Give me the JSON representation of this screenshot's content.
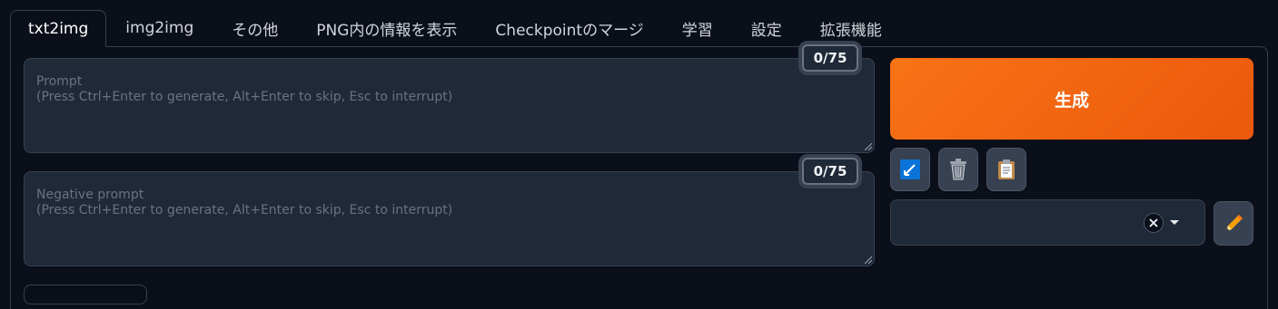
{
  "tabs": [
    {
      "label": "txt2img",
      "active": true
    },
    {
      "label": "img2img"
    },
    {
      "label": "その他"
    },
    {
      "label": "PNG内の情報を表示"
    },
    {
      "label": "Checkpointのマージ"
    },
    {
      "label": "学習"
    },
    {
      "label": "設定"
    },
    {
      "label": "拡張機能"
    }
  ],
  "prompt": {
    "placeholder_line1": "Prompt",
    "placeholder_line2": "(Press Ctrl+Enter to generate, Alt+Enter to skip, Esc to interrupt)",
    "value": "",
    "token_counter": "0/75"
  },
  "negative_prompt": {
    "placeholder_line1": "Negative prompt",
    "placeholder_line2": "(Press Ctrl+Enter to generate, Alt+Enter to skip, Esc to interrupt)",
    "value": "",
    "token_counter": "0/75"
  },
  "generate_button": {
    "label": "生成"
  },
  "tool_buttons": [
    {
      "icon": "check-mark-icon"
    },
    {
      "icon": "trash-icon"
    },
    {
      "icon": "clipboard-icon"
    }
  ],
  "styles_dropdown": {
    "value": ""
  },
  "edit_button": {
    "icon": "pencil-icon"
  },
  "colors": {
    "background": "#0b0f19",
    "panel": "#1f2937",
    "border": "#374151",
    "accent": "#f97316",
    "check_blue": "#0b74d8"
  }
}
